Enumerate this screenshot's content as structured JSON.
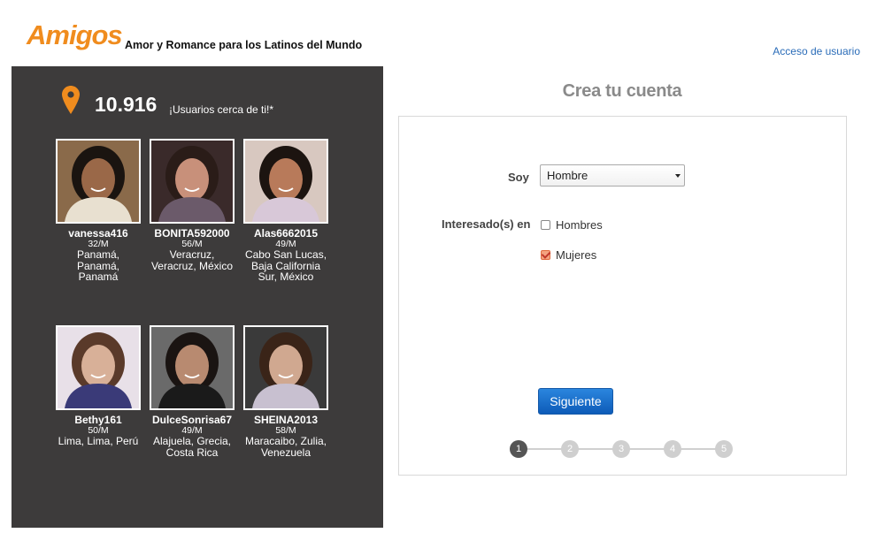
{
  "header": {
    "logo": "Amigos",
    "tagline": "Amor y Romance para los Latinos del Mundo",
    "login_link": "Acceso de usuario"
  },
  "nearby": {
    "count": "10.916",
    "label": "¡Usuarios cerca de ti!*"
  },
  "members": [
    {
      "username": "vanessa416",
      "age": "32/M",
      "location": "Panamá, Panamá, Panamá",
      "loc_lines": [
        "Panamá,",
        "Panamá,",
        "Panamá"
      ]
    },
    {
      "username": "BONITA592000",
      "age": "56/M",
      "location": "Veracruz, Veracruz, México",
      "loc_lines": [
        "Veracruz,",
        "Veracruz, México"
      ]
    },
    {
      "username": "Alas6662015",
      "age": "49/M",
      "location": "Cabo San Lucas, Baja California Sur, México",
      "loc_lines": [
        "Cabo San Lucas,",
        "Baja California",
        "Sur, México"
      ]
    },
    {
      "username": "Bethy161",
      "age": "50/M",
      "location": "Lima, Lima, Perú",
      "loc_lines": [
        "Lima, Lima, Perú"
      ]
    },
    {
      "username": "DulceSonrisa67",
      "age": "49/M",
      "location": "Alajuela, Grecia, Costa Rica",
      "loc_lines": [
        "Alajuela, Grecia,",
        "Costa Rica"
      ]
    },
    {
      "username": "SHEINA2013",
      "age": "58/M",
      "location": "Maracaibo, Zulia, Venezuela",
      "loc_lines": [
        "Maracaibo, Zulia,",
        "Venezuela"
      ]
    }
  ],
  "form": {
    "title": "Crea tu cuenta",
    "soy_label": "Soy",
    "soy_value": "Hombre",
    "interest_label": "Interesado(s) en",
    "options": [
      {
        "label": "Hombres",
        "checked": false
      },
      {
        "label": "Mujeres",
        "checked": true
      }
    ],
    "next_button": "Siguiente",
    "steps": [
      "1",
      "2",
      "3",
      "4",
      "5"
    ],
    "active_step": 1
  },
  "colors": {
    "brand": "#f08c1e",
    "panel": "#3d3b3b",
    "button": "#0d5bb8",
    "link": "#2a6cb8"
  }
}
